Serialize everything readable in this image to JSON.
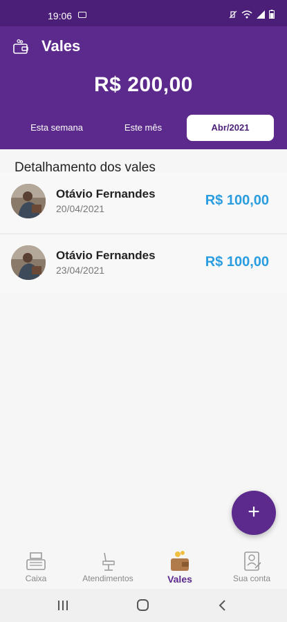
{
  "status_bar": {
    "time": "19:06"
  },
  "header": {
    "title": "Vales",
    "icon": "wallet-icon",
    "total": "R$ 200,00",
    "tabs": [
      {
        "label": "Esta semana",
        "active": false
      },
      {
        "label": "Este mês",
        "active": false
      },
      {
        "label": "Abr/2021",
        "active": true
      }
    ]
  },
  "section_title": "Detalhamento dos vales",
  "vales": [
    {
      "name": "Otávio Fernandes",
      "date": "20/04/2021",
      "amount": "R$ 100,00"
    },
    {
      "name": "Otávio Fernandes",
      "date": "23/04/2021",
      "amount": "R$ 100,00"
    }
  ],
  "fab": {
    "symbol": "+",
    "icon": "plus-icon"
  },
  "bottom_nav": [
    {
      "label": "Caixa",
      "icon": "cash-register-icon",
      "active": false
    },
    {
      "label": "Atendimentos",
      "icon": "barber-chair-icon",
      "active": false
    },
    {
      "label": "Vales",
      "icon": "wallet-coins-icon",
      "active": true
    },
    {
      "label": "Sua conta",
      "icon": "account-document-icon",
      "active": false
    }
  ],
  "colors": {
    "primary": "#5b2a8c",
    "status_bar": "#4b1f78",
    "amount_blue": "#2a9de0",
    "active_tab_bg": "#ffffff"
  }
}
